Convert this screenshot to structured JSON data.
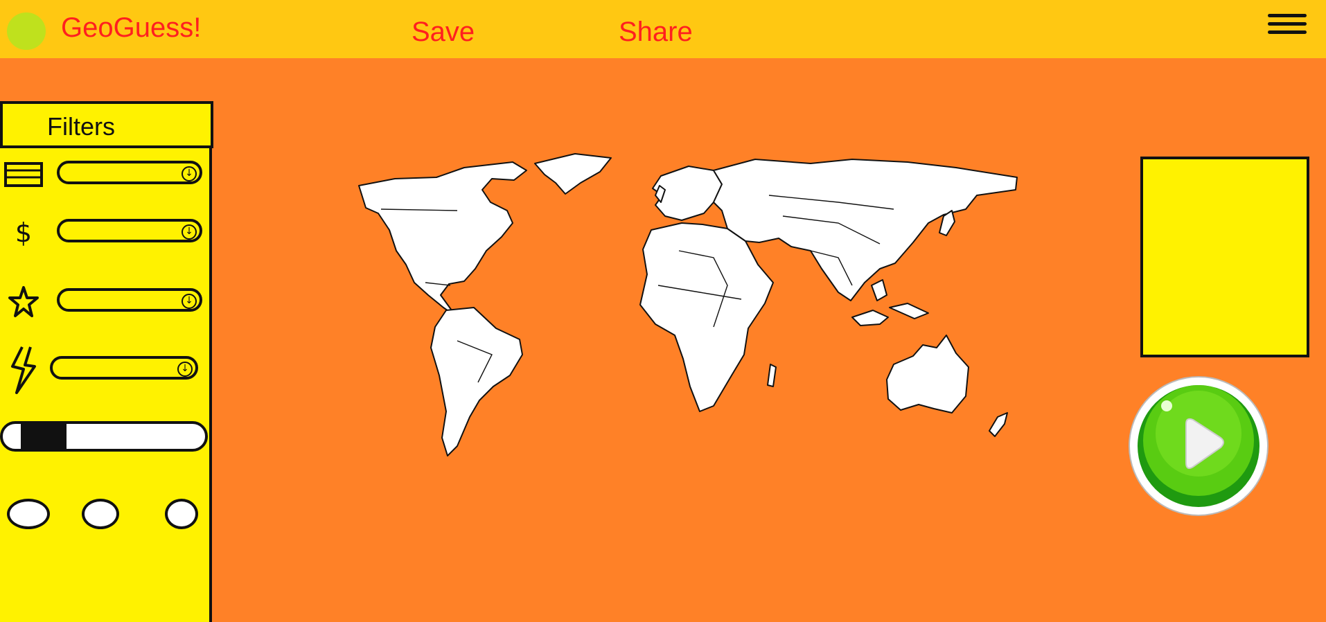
{
  "header": {
    "app_title": "GeoGuess!",
    "save_label": "Save",
    "share_label": "Share"
  },
  "sidebar": {
    "title": "Filters",
    "filters": [
      {
        "icon": "list-icon",
        "value": ""
      },
      {
        "icon": "dollar-icon",
        "value": ""
      },
      {
        "icon": "star-icon",
        "value": ""
      },
      {
        "icon": "lightning-icon",
        "value": ""
      }
    ],
    "dollar_glyph": "$",
    "slider_value": 0.2,
    "radio_count": 3
  },
  "colors": {
    "topbar": "#ffc812",
    "background": "#ff8127",
    "panel": "#fff200",
    "title_text": "#ff1f1f",
    "play_button": "#4fc71a"
  }
}
